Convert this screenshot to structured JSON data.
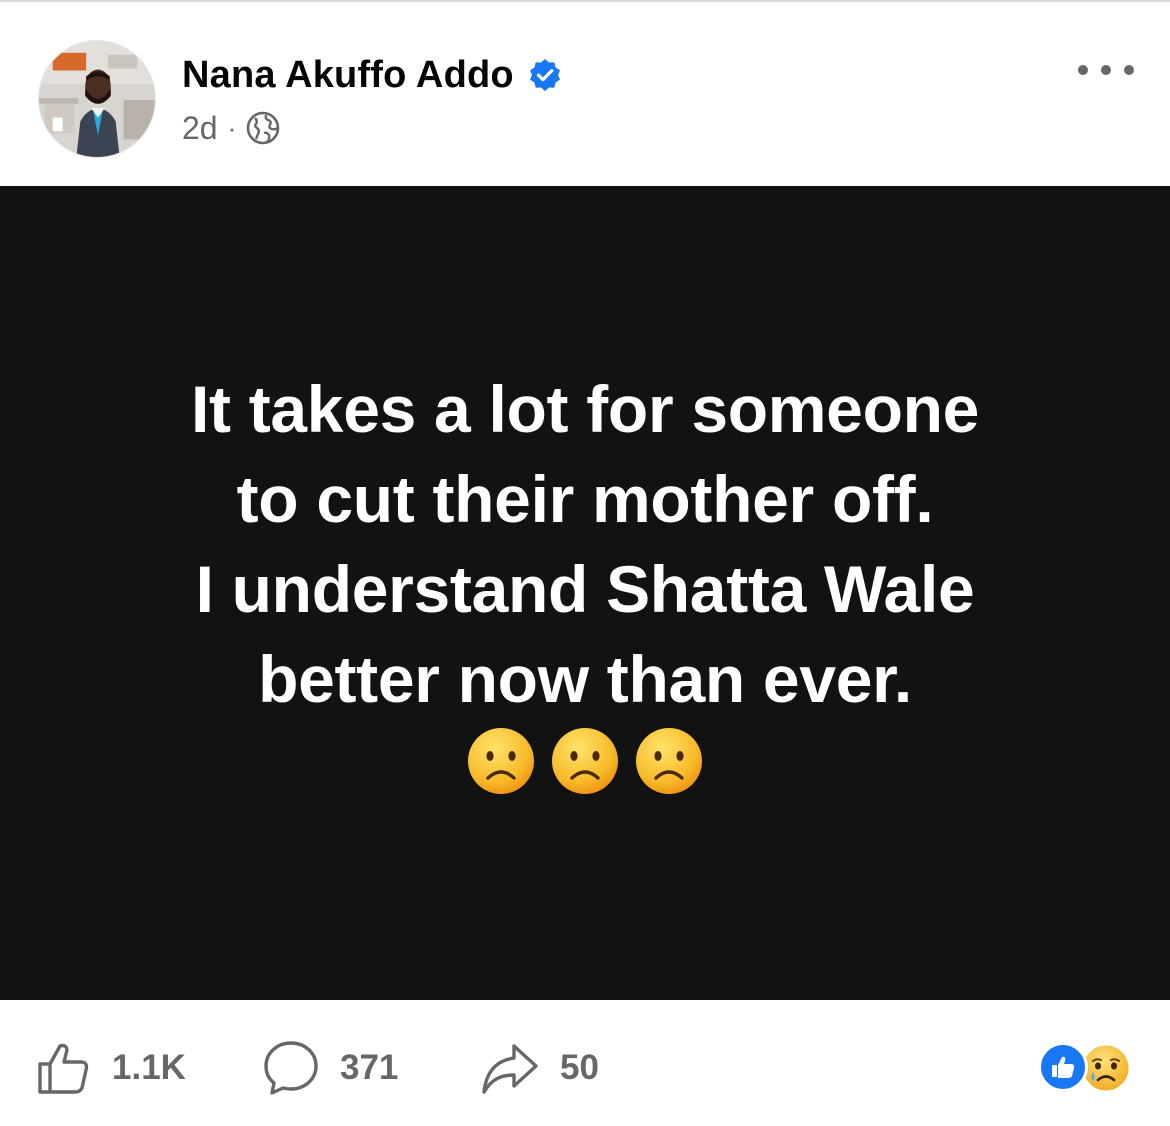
{
  "post": {
    "author": {
      "name": "Nana Akuffo Addo",
      "verified": true,
      "avatar_icon": "profile-photo"
    },
    "timestamp": "2d",
    "separator": "·",
    "audience_icon": "globe-icon",
    "more_icon": "more-horizontal-icon",
    "background_color": "#121212",
    "text_lines": [
      "It takes a lot for someone",
      "to cut their mother off.",
      "I understand Shatta Wale",
      "better now than ever."
    ],
    "emojis": [
      "frowning-face",
      "frowning-face",
      "frowning-face"
    ]
  },
  "actions": {
    "like": {
      "icon": "thumbs-up-outline-icon",
      "count": "1.1K"
    },
    "comment": {
      "icon": "comment-bubble-icon",
      "count": "371"
    },
    "share": {
      "icon": "share-arrow-icon",
      "count": "50"
    }
  },
  "reactions": [
    "like",
    "sad"
  ],
  "colors": {
    "verified_blue": "#1877f2",
    "secondary_text": "#65676b",
    "emoji_yellow": "#f7b928"
  }
}
